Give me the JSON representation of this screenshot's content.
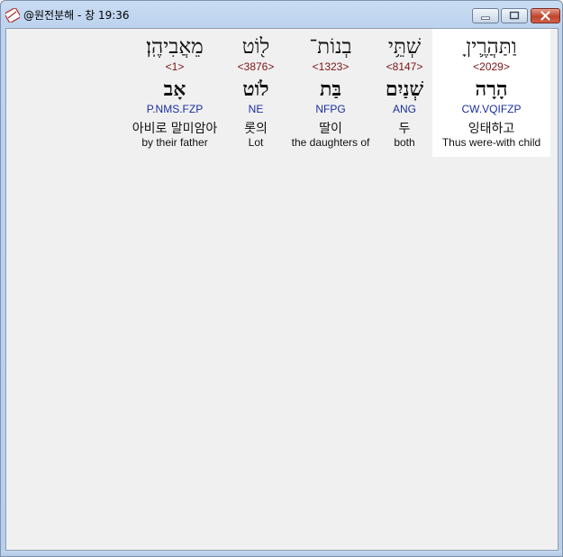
{
  "window": {
    "title": "@원전분해 - 창 19:36"
  },
  "colors": {
    "strong_number": "#7a1414",
    "parsing_code": "#1a2fa0",
    "highlight_bg": "#ffffff"
  },
  "words": [
    {
      "hebrew": "וַתַּהֲרֶ֛יןָ",
      "strong": "<2029>",
      "lexeme": "הָרָה",
      "parsing": "CW.VQIFZP",
      "korean": "잉태하고",
      "english": "Thus were-with child",
      "highlighted": true
    },
    {
      "hebrew": "שְׁתֵּ֥י",
      "strong": "<8147>",
      "lexeme": "שְׁנַיִם",
      "parsing": "ANG",
      "korean": "두",
      "english": "both",
      "highlighted": false
    },
    {
      "hebrew": "בְנוֹת־",
      "strong": "<1323>",
      "lexeme": "בַּת",
      "parsing": "NFPG",
      "korean": "딸이",
      "english": "the daughters of",
      "highlighted": false
    },
    {
      "hebrew": "ל֖וֹט",
      "strong": "<3876>",
      "lexeme": "לֹוט",
      "parsing": "NE",
      "korean": "롯의",
      "english": "Lot",
      "highlighted": false
    },
    {
      "hebrew": "מֵאֲבִיהֶֽן׃",
      "strong": "<1>",
      "lexeme": "אָב",
      "parsing": "P.NMS.FZP",
      "korean": "아비로 말미암아",
      "english": "by their father",
      "highlighted": false
    }
  ]
}
